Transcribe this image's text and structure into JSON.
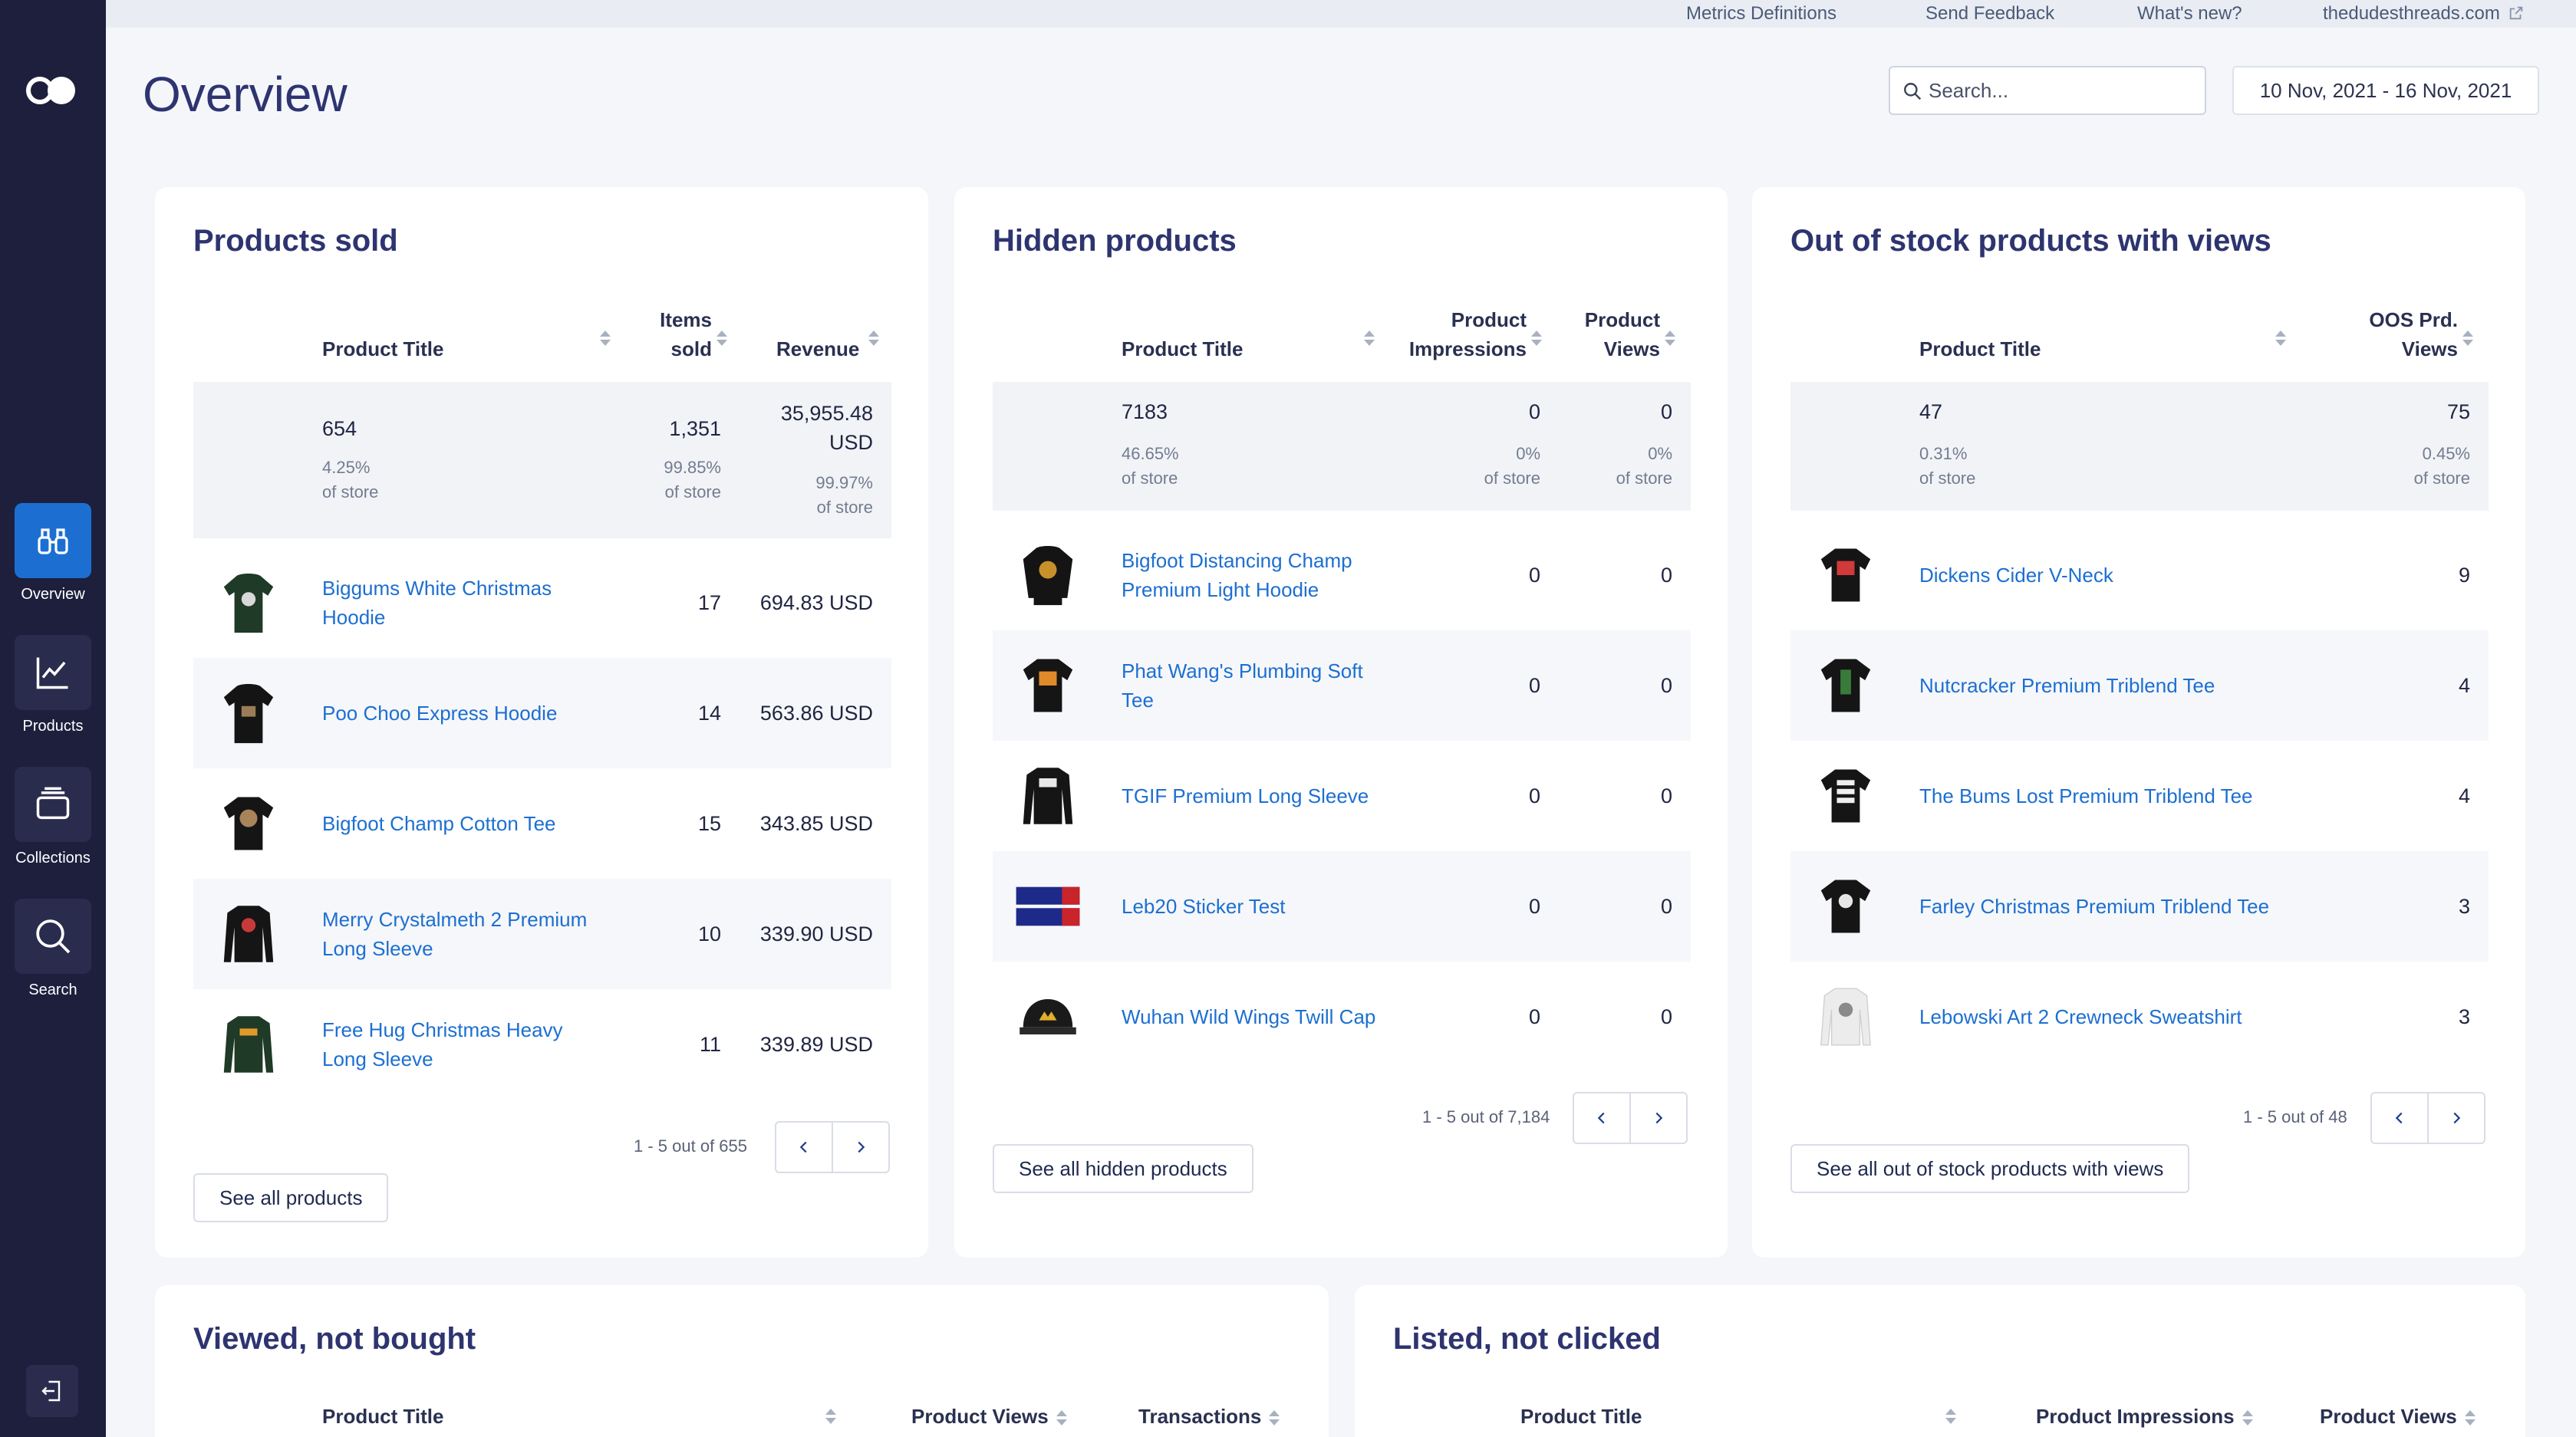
{
  "topbar": {
    "links": [
      "Metrics Definitions",
      "Send Feedback",
      "What's new?",
      "thedudesthreads.com"
    ]
  },
  "sidebar": {
    "items": [
      {
        "label": "Overview",
        "icon": "binoculars-icon"
      },
      {
        "label": "Products",
        "icon": "trend-chart-icon"
      },
      {
        "label": "Collections",
        "icon": "stack-icon"
      },
      {
        "label": "Search",
        "icon": "search-icon"
      }
    ]
  },
  "header": {
    "title": "Overview",
    "search_placeholder": "Search...",
    "date_range": "10 Nov, 2021 - 16 Nov, 2021"
  },
  "products_sold": {
    "title": "Products sold",
    "headers": [
      "Product Title",
      "Items",
      "sold",
      "Revenue"
    ],
    "summary": {
      "count": "654",
      "count_pct": "4.25%",
      "count_of": "of store",
      "items": "1,351",
      "items_pct": "99.85%",
      "items_of": "of store",
      "revenue": "35,955.48",
      "revenue_unit": "USD",
      "revenue_pct": "99.97%",
      "revenue_of": "of store"
    },
    "rows": [
      {
        "title": "Biggums White Christmas Hoodie",
        "items": "17",
        "revenue": "694.83 USD"
      },
      {
        "title": "Poo Choo Express Hoodie",
        "items": "14",
        "revenue": "563.86 USD"
      },
      {
        "title": "Bigfoot Champ Cotton Tee",
        "items": "15",
        "revenue": "343.85 USD"
      },
      {
        "title": "Merry Crystalmeth 2 Premium Long Sleeve",
        "items": "10",
        "revenue": "339.90 USD"
      },
      {
        "title": "Free Hug Christmas Heavy Long Sleeve",
        "items": "11",
        "revenue": "339.89 USD"
      }
    ],
    "pagination": "1 - 5 out of 655",
    "see_all": "See all products"
  },
  "hidden_products": {
    "title": "Hidden products",
    "headers": [
      "Product Title",
      "Product",
      "Impressions",
      "Product",
      "Views"
    ],
    "summary": {
      "count": "7183",
      "count_pct": "46.65%",
      "count_of": "of store",
      "impressions": "0",
      "impressions_pct": "0%",
      "impressions_of": "of store",
      "views": "0",
      "views_pct": "0%",
      "views_of": "of store"
    },
    "rows": [
      {
        "title": "Bigfoot Distancing Champ Premium Light Hoodie",
        "impressions": "0",
        "views": "0"
      },
      {
        "title": "Phat Wang's Plumbing Soft Tee",
        "impressions": "0",
        "views": "0"
      },
      {
        "title": "TGIF Premium Long Sleeve",
        "impressions": "0",
        "views": "0"
      },
      {
        "title": "Leb20 Sticker Test",
        "impressions": "0",
        "views": "0"
      },
      {
        "title": "Wuhan Wild Wings Twill Cap",
        "impressions": "0",
        "views": "0"
      }
    ],
    "pagination": "1 - 5 out of 7,184",
    "see_all": "See all hidden products"
  },
  "oos_products": {
    "title": "Out of stock products with views",
    "headers": [
      "Product Title",
      "OOS Prd.",
      "Views"
    ],
    "summary": {
      "count": "47",
      "count_pct": "0.31%",
      "count_of": "of store",
      "views": "75",
      "views_pct": "0.45%",
      "views_of": "of store"
    },
    "rows": [
      {
        "title": "Dickens Cider V-Neck",
        "views": "9"
      },
      {
        "title": "Nutcracker Premium Triblend Tee",
        "views": "4"
      },
      {
        "title": "The Bums Lost Premium Triblend Tee",
        "views": "4"
      },
      {
        "title": "Farley Christmas Premium Triblend Tee",
        "views": "3"
      },
      {
        "title": "Lebowski Art 2 Crewneck Sweatshirt",
        "views": "3"
      }
    ],
    "pagination": "1 - 5 out of 48",
    "see_all": "See all out of stock products with views"
  },
  "viewed_not_bought": {
    "title": "Viewed, not bought",
    "headers": [
      "Product Title",
      "Product Views",
      "Transactions"
    ]
  },
  "listed_not_clicked": {
    "title": "Listed, not clicked",
    "headers": [
      "Product Title",
      "Product Impressions",
      "Product Views"
    ]
  },
  "colors": {
    "accent": "#1c6fd1",
    "sidebar": "#1d1f3d",
    "title": "#2e3470"
  }
}
